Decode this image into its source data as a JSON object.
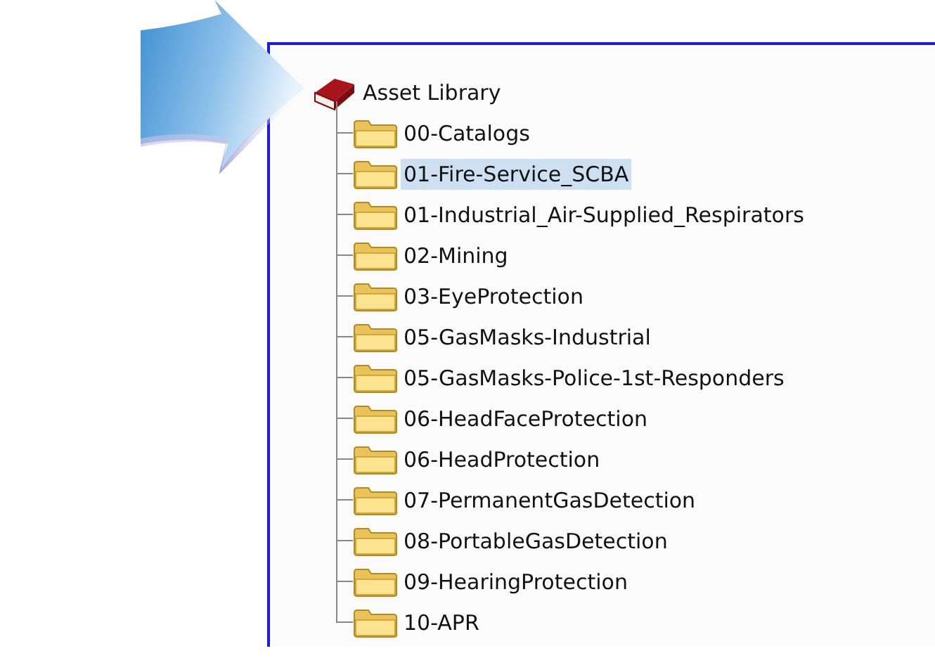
{
  "tree": {
    "label": "Asset Library",
    "children": [
      {
        "label": "00-Catalogs",
        "selected": false
      },
      {
        "label": "01-Fire-Service_SCBA",
        "selected": true
      },
      {
        "label": "01-Industrial_Air-Supplied_Respirators",
        "selected": false
      },
      {
        "label": "02-Mining",
        "selected": false
      },
      {
        "label": "03-EyeProtection",
        "selected": false
      },
      {
        "label": "05-GasMasks-Industrial",
        "selected": false
      },
      {
        "label": "05-GasMasks-Police-1st-Responders",
        "selected": false
      },
      {
        "label": "06-HeadFaceProtection",
        "selected": false
      },
      {
        "label": "06-HeadProtection",
        "selected": false
      },
      {
        "label": "07-PermanentGasDetection",
        "selected": false
      },
      {
        "label": "08-PortableGasDetection",
        "selected": false
      },
      {
        "label": "09-HearingProtection",
        "selected": false
      },
      {
        "label": "10-APR",
        "selected": false
      }
    ]
  }
}
